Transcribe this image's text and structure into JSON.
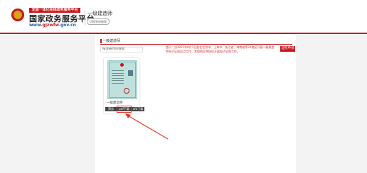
{
  "header": {
    "banner": "全国一体化在线政务服务平台",
    "title": "国家政务服务平台",
    "url_prefix": "www.",
    "url_highlight": "gjzwfw",
    "url_suffix": ".gov.cn",
    "site_name": "一级建造师",
    "switch_label": "切换到电脑版"
  },
  "panel": {
    "title": "一级建造师",
    "search_placeholder": "按注册时间搜索",
    "notice": "提示：自2021年8月1日起在北京市、上海市、浙江省、海南省等31地区开展一级建造师电子证照试点工作，其他地区将陆续开展电子证照工作。",
    "apply_label": "证照申领"
  },
  "card": {
    "name": "一级建造师",
    "preview_label": "预览",
    "pdf_label": "pdf下载",
    "ofd_label": "ofd下载"
  },
  "colors": {
    "brand_red": "#c8161d",
    "cert_bg": "#bfe1dd",
    "annotation": "#e8352e"
  }
}
